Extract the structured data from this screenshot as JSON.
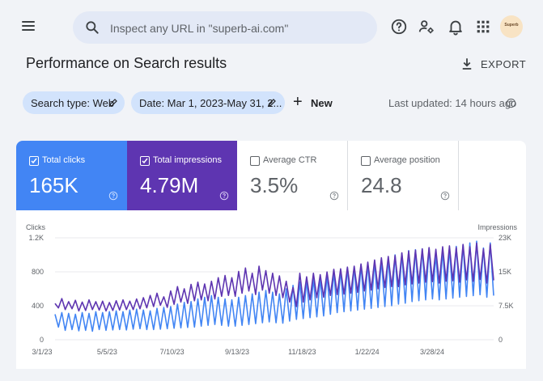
{
  "search": {
    "placeholder": "Inspect any URL in \"superb-ai.com\""
  },
  "header": {
    "title": "Performance on Search results",
    "export_label": "EXPORT",
    "avatar_text": "Superb"
  },
  "filters": {
    "search_type": "Search type: Web",
    "date": "Date: Mar 1, 2023-May 31, 2...",
    "new_label": "New",
    "last_updated": "Last updated: 14 hours ago"
  },
  "metrics": [
    {
      "label": "Total clicks",
      "value": "165K",
      "checked": true
    },
    {
      "label": "Total impressions",
      "value": "4.79M",
      "checked": true
    },
    {
      "label": "Average CTR",
      "value": "3.5%",
      "checked": false
    },
    {
      "label": "Average position",
      "value": "24.8",
      "checked": false
    }
  ],
  "chart_data": {
    "type": "line",
    "left_axis": {
      "title": "Clicks",
      "ticks": [
        "1.2K",
        "800",
        "400",
        "0"
      ],
      "range": [
        0,
        1200
      ]
    },
    "right_axis": {
      "title": "Impressions",
      "ticks": [
        "23K",
        "15K",
        "7.5K",
        "0"
      ],
      "range": [
        0,
        23000
      ]
    },
    "x_ticks": [
      "3/1/23",
      "5/5/23",
      "7/10/23",
      "9/13/23",
      "11/18/23",
      "1/22/24",
      "3/28/24"
    ],
    "x_range": [
      "2023-03-01",
      "2024-05-31"
    ],
    "grid": true,
    "series": [
      {
        "name": "Total clicks",
        "axis": "left",
        "color": "#4285f4",
        "weekly_high": [
          300,
          320,
          310,
          300,
          320,
          310,
          330,
          320,
          330,
          340,
          330,
          350,
          360,
          350,
          340,
          370,
          380,
          390,
          420,
          440,
          450,
          480,
          500,
          520,
          500,
          480,
          470,
          500,
          520,
          540,
          560,
          580,
          560,
          540,
          600,
          640,
          680,
          700,
          720,
          720,
          760,
          800,
          820,
          850,
          860,
          880,
          900,
          920,
          940,
          960,
          1000,
          1020,
          1050,
          1060,
          1070,
          1080,
          1000,
          1050,
          1080,
          1100,
          1120,
          1140,
          1160,
          1080,
          1140
        ],
        "weekly_low": [
          150,
          110,
          120,
          105,
          110,
          100,
          120,
          110,
          115,
          120,
          115,
          125,
          130,
          120,
          120,
          125,
          130,
          135,
          140,
          145,
          150,
          160,
          170,
          180,
          170,
          160,
          160,
          170,
          180,
          190,
          200,
          210,
          200,
          195,
          220,
          240,
          250,
          260,
          270,
          280,
          300,
          320,
          330,
          340,
          350,
          360,
          370,
          380,
          390,
          400,
          420,
          430,
          450,
          460,
          470,
          480,
          470,
          480,
          490,
          500,
          510,
          520,
          530,
          500,
          520
        ]
      },
      {
        "name": "Total impressions",
        "axis": "right",
        "color": "#5e35b1",
        "weekly_high": [
          8200,
          9300,
          8600,
          8900,
          8500,
          9000,
          8600,
          8700,
          8400,
          8800,
          9000,
          8700,
          9200,
          9500,
          10000,
          10500,
          9700,
          11000,
          12000,
          11500,
          12500,
          13000,
          12600,
          13200,
          14000,
          14500,
          14000,
          15400,
          16200,
          15000,
          16600,
          15600,
          15000,
          14400,
          13200,
          11800,
          15000,
          14200,
          15000,
          14700,
          15300,
          15900,
          16000,
          16400,
          16600,
          17100,
          17500,
          18000,
          18500,
          18800,
          19000,
          19600,
          20000,
          20200,
          20500,
          20800,
          20400,
          21000,
          21200,
          20800,
          21500,
          21000,
          21800,
          20500,
          21500
        ],
        "weekly_low": [
          7200,
          6800,
          7000,
          6500,
          6600,
          6800,
          6700,
          6500,
          6600,
          6700,
          6800,
          6800,
          7000,
          7200,
          7500,
          7800,
          7300,
          8000,
          8500,
          8200,
          8800,
          9000,
          8800,
          9200,
          9800,
          10000,
          9800,
          10500,
          11000,
          10200,
          11200,
          10500,
          10000,
          9500,
          8500,
          7500,
          8500,
          9000,
          9500,
          9600,
          10000,
          10200,
          10300,
          10500,
          10700,
          11000,
          11200,
          11500,
          11800,
          12000,
          12000,
          12400,
          12600,
          12800,
          13000,
          13100,
          12800,
          13200,
          13300,
          13000,
          13500,
          13200,
          13600,
          12800,
          13400
        ]
      }
    ]
  }
}
